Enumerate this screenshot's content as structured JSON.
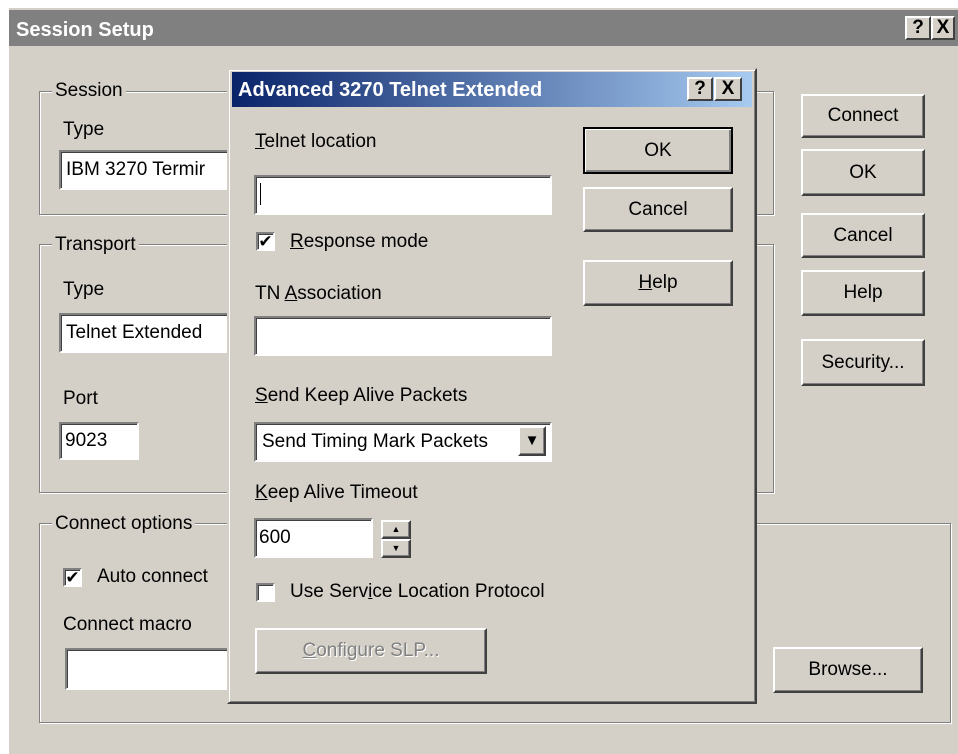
{
  "outer": {
    "title": "Session Setup",
    "help_glyph": "?",
    "close_glyph": "X",
    "session_group": {
      "legend": "Session",
      "type_label": "Type",
      "type_value": "IBM 3270 Termir"
    },
    "transport_group": {
      "legend": "Transport",
      "type_label": "Type",
      "type_value": "Telnet Extended",
      "port_label": "Port",
      "port_value": "9023"
    },
    "connect_group": {
      "legend": "Connect options",
      "auto_connect_label": "Auto connect",
      "auto_connect_checked": true,
      "macro_label": "Connect macro",
      "macro_value": ""
    },
    "buttons": {
      "connect": "Connect",
      "ok": "OK",
      "cancel": "Cancel",
      "help": "Help",
      "security": "Security...",
      "browse": "Browse..."
    }
  },
  "inner": {
    "title": "Advanced 3270 Telnet Extended",
    "help_glyph": "?",
    "close_glyph": "X",
    "telnet_location": {
      "mnemonic": "T",
      "rest": "elnet location",
      "value": ""
    },
    "response_mode": {
      "mnemonic": "R",
      "rest": "esponse mode",
      "checked": true
    },
    "tn_association": {
      "pre": "TN ",
      "mnemonic": "A",
      "rest": "ssociation",
      "value": ""
    },
    "keep_alive_packets": {
      "mnemonic": "S",
      "rest": "end Keep Alive Packets",
      "value": "Send Timing Mark Packets"
    },
    "keep_alive_timeout": {
      "mnemonic": "K",
      "rest": "eep Alive Timeout",
      "value": "600"
    },
    "use_slp": {
      "pre": "Use Serv",
      "mnemonic": "i",
      "rest": "ce Location Protocol",
      "checked": false
    },
    "configure_slp": {
      "mnemonic": "C",
      "rest": "onfigure SLP..."
    },
    "buttons": {
      "ok": "OK",
      "cancel": "Cancel",
      "help_mnemonic": "H",
      "help_rest": "elp"
    }
  },
  "icons": {
    "checkmark": "✔",
    "dropdown": "▼",
    "spin_up": "▲",
    "spin_down": "▼"
  }
}
